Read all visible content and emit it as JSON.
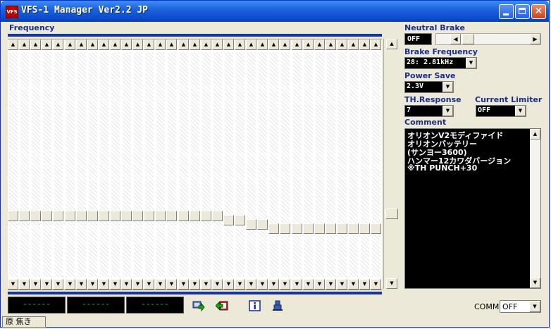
{
  "window": {
    "title": "VFS-1 Manager Ver2.2 JP",
    "icon_text": "VFS"
  },
  "frequency": {
    "label": "Frequency",
    "channel_levels": [
      0,
      0,
      0,
      0,
      0,
      0,
      0,
      0,
      0,
      0,
      0,
      0,
      0,
      0,
      0,
      0,
      0,
      0,
      0,
      1,
      1,
      2,
      2,
      3,
      3,
      3,
      3,
      3,
      3,
      3,
      3,
      3,
      3
    ],
    "master_level": 0
  },
  "neutral_brake": {
    "label": "Neutral Brake",
    "value": "OFF"
  },
  "brake_frequency": {
    "label": "Brake Frequency",
    "value": "28:  2.81kHz"
  },
  "power_save": {
    "label": "Power Save",
    "value": "2.3V"
  },
  "th_response": {
    "label": "TH.Response",
    "value": "7"
  },
  "current_limiter": {
    "label": "Current Limiter",
    "value": "OFF"
  },
  "comment": {
    "label": "Comment",
    "lines": [
      "オリオンV2モディファイド",
      "オリオンバッテリー",
      "(サンヨー3600)",
      "ハンマー12カワダバージョン",
      "※TH  PUNCH+30"
    ]
  },
  "displays": [
    "------",
    "------",
    "------"
  ],
  "comm": {
    "label": "COMM",
    "value": "OFF"
  },
  "statusbar": {
    "text": "原 焦き"
  },
  "icons": {
    "send": "send-to-device-icon",
    "receive": "receive-from-device-icon",
    "info": "info-icon",
    "exit": "exit-icon"
  },
  "colors": {
    "title_bar": "#1c63dd",
    "label_text": "#1b2d8a",
    "lcd_green": "#11d611",
    "freq_bar": "#18349a"
  }
}
